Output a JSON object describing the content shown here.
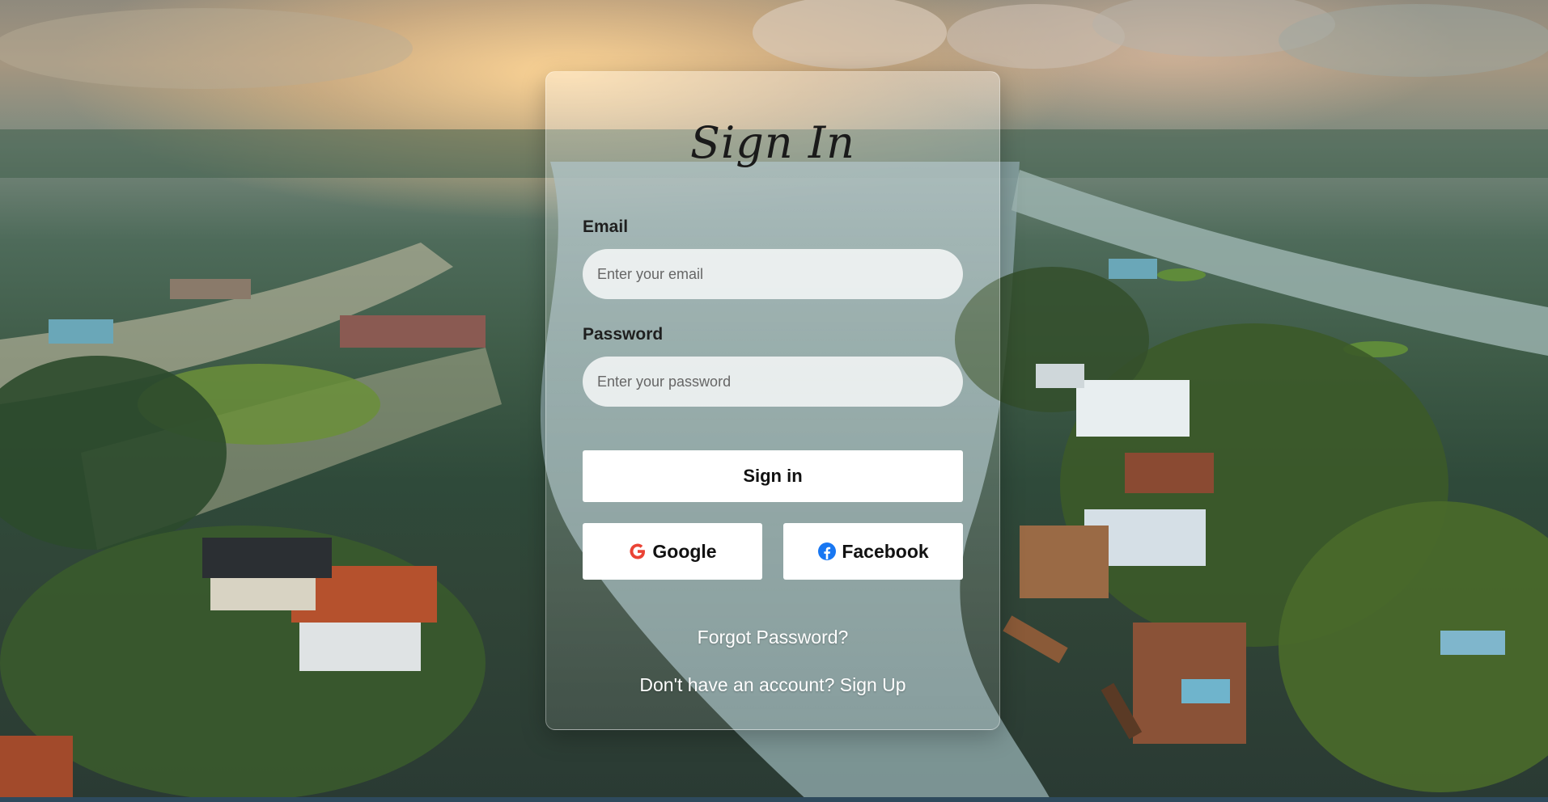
{
  "title": "Sign In",
  "form": {
    "email_label": "Email",
    "email_placeholder": "Enter your email",
    "email_value": "",
    "password_label": "Password",
    "password_placeholder": "Enter your password",
    "password_value": "",
    "signin_label": "Sign in"
  },
  "social": {
    "google_label": "Google",
    "google_icon": "google-g-icon",
    "facebook_label": "Facebook",
    "facebook_icon": "facebook-icon"
  },
  "links": {
    "forgot": "Forgot Password?",
    "no_account": "Don't have an account?",
    "signup": "Sign Up"
  },
  "colors": {
    "google_red": "#ea4335",
    "facebook_blue": "#1877f2",
    "button_bg": "#ffffff"
  }
}
